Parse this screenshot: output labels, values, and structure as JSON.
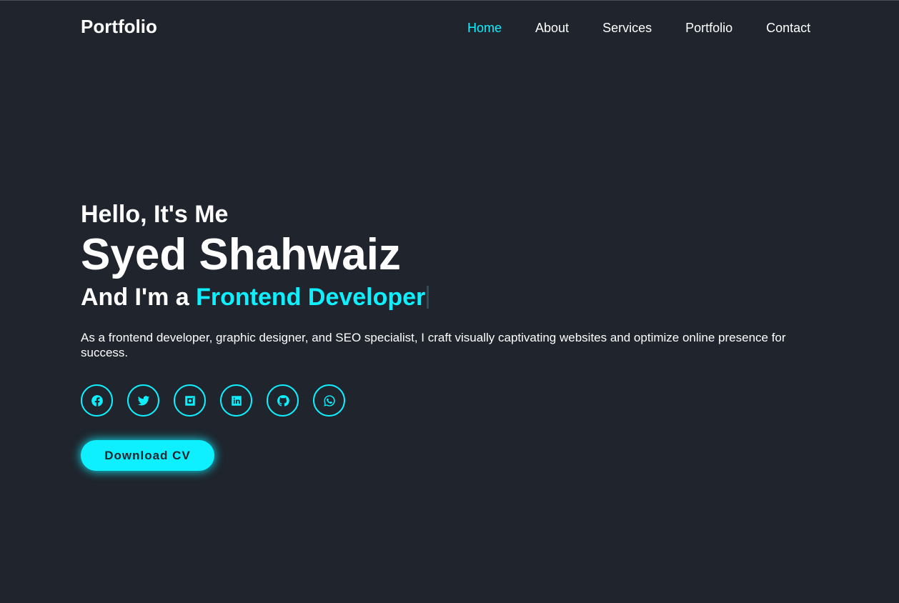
{
  "header": {
    "logo": "Portfolio",
    "nav": [
      {
        "label": "Home",
        "active": true
      },
      {
        "label": "About",
        "active": false
      },
      {
        "label": "Services",
        "active": false
      },
      {
        "label": "Portfolio",
        "active": false
      },
      {
        "label": "Contact",
        "active": false
      }
    ]
  },
  "hero": {
    "greeting": "Hello, It's Me",
    "name": "Syed Shahwaiz",
    "role_prefix": "And I'm a",
    "role_highlight": "Frontend Developer",
    "description": "As a frontend developer, graphic designer, and SEO specialist, I craft visually captivating websites and optimize online presence for success.",
    "social_icons": [
      "facebook-icon",
      "twitter-icon",
      "instagram-icon",
      "linkedin-icon",
      "github-icon",
      "whatsapp-icon"
    ],
    "cta_label": "Download CV"
  },
  "colors": {
    "background": "#1f242d",
    "accent": "#0ef0ff",
    "text": "#ffffff"
  }
}
